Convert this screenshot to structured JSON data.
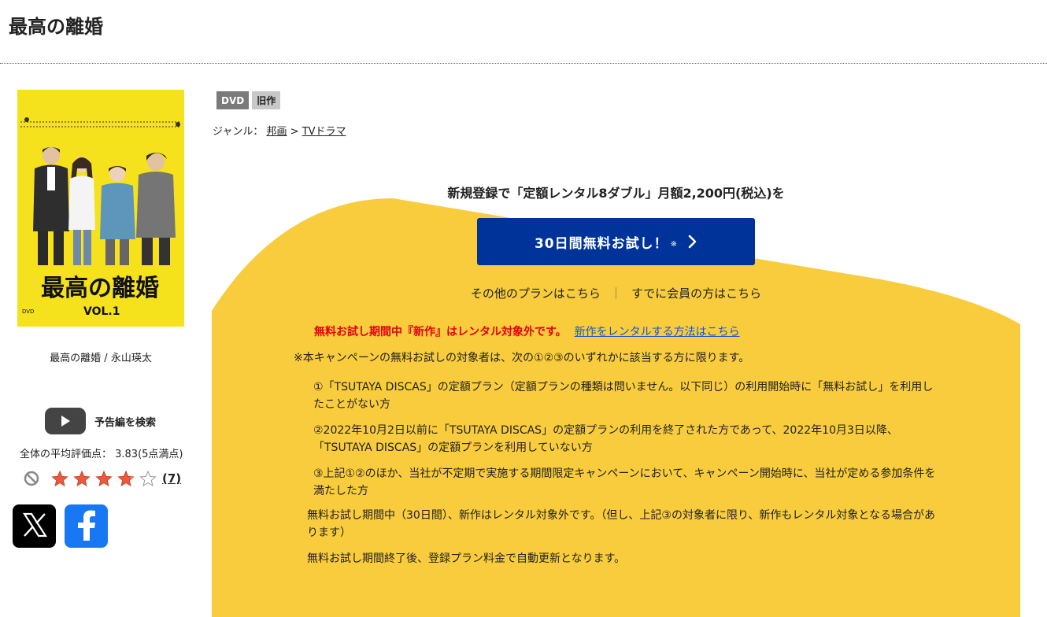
{
  "page": {
    "title": "最高の離婚"
  },
  "product": {
    "jacket": {
      "title_text": "最高の離婚",
      "volume_text": "VOL.1",
      "format_text": "DVD"
    },
    "caption": "最高の離婚 / 永山瑛太",
    "badges": [
      "DVD",
      "旧作"
    ],
    "genre": {
      "prefix": "ジャンル：",
      "crumbs": [
        "邦画",
        "TVドラマ"
      ],
      "separator": ">"
    }
  },
  "trailer": {
    "label": "予告編を検索"
  },
  "rating": {
    "summary": "全体の平均評価点： 3.83(5点満点)",
    "value": 3.83,
    "max": 5,
    "review_count": "(7)"
  },
  "share": {
    "icons": [
      "x-logo-icon",
      "facebook-logo-icon"
    ]
  },
  "promo": {
    "headline": "新規登録で「定額レンタル8ダブル」月額2,200円(税込)を",
    "button_label": "30日間無料お試し！",
    "button_mark": "※",
    "other_plans": "その他のプランはこちら",
    "separator": "｜",
    "members": "すでに会員の方はこちら",
    "warning": "無料お試し期間中『新作』はレンタル対象外です。",
    "warning_link": "新作をレンタルする方法はこちら",
    "note_lead": "※本キャンペーンの無料お試しの対象者は、次の①②③のいずれかに該当する方に限ります。",
    "conditions": [
      "①「TSUTAYA DISCAS」の定額プラン（定額プランの種類は問いません。以下同じ）の利用開始時に「無料お試し」を利用したことがない方",
      "②2022年10月2日以前に「TSUTAYA DISCAS」の定額プランの利用を終了された方であって、2022年10月3日以降、「TSUTAYA DISCAS」の定額プランを利用していない方",
      "③上記①②のほか、当社が不定期で実施する期間限定キャンペーンにおいて、キャンペーン開始時に、当社が定める参加条件を満たした方"
    ],
    "trial_note": "無料お試し期間中（30日間）、新作はレンタル対象外です。（但し、上記③の対象者に限り、新作もレンタル対象となる場合があります）",
    "renewal_note": "無料お試し期間終了後、登録プラン料金で自動更新となります。"
  },
  "colors": {
    "promo_yellow": "#f8cc3d",
    "button_blue": "#003399",
    "warning_red": "#e60012",
    "link_blue": "#1a56c8",
    "jacket_yellow": "#f5e21c",
    "facebook_blue": "#1877f2"
  }
}
